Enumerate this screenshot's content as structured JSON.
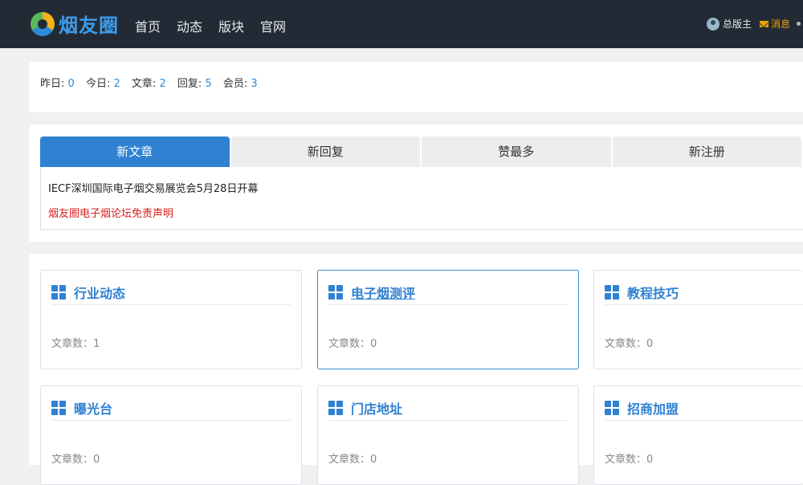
{
  "header": {
    "logo_text": "烟友圈",
    "nav": [
      "首页",
      "动态",
      "版块",
      "官网"
    ],
    "user_label": "总版主",
    "msg_label": "消息"
  },
  "stats": [
    {
      "label": "昨日:",
      "value": "0"
    },
    {
      "label": "今日:",
      "value": "2"
    },
    {
      "label": "文章:",
      "value": "2"
    },
    {
      "label": "回复:",
      "value": "5"
    },
    {
      "label": "会员:",
      "value": "3"
    }
  ],
  "tabs": [
    "新文章",
    "新回复",
    "赞最多",
    "新注册"
  ],
  "active_tab": 0,
  "posts": [
    {
      "title": "IECF深圳国际电子烟交易展览会5月28日开幕",
      "color": "#222222"
    },
    {
      "title": "烟友圈电子烟论坛免责声明",
      "color": "#d62020"
    }
  ],
  "forums": [
    {
      "name": "行业动态",
      "count_label": "文章数：1"
    },
    {
      "name": "电子烟测评",
      "count_label": "文章数：0"
    },
    {
      "name": "教程技巧",
      "count_label": "文章数：0"
    },
    {
      "name": "曝光台",
      "count_label": "文章数：0"
    },
    {
      "name": "门店地址",
      "count_label": "文章数：0"
    },
    {
      "name": "招商加盟",
      "count_label": "文章数：0"
    }
  ],
  "accent_color": "#2f81d2",
  "header_bg": "#222b35"
}
